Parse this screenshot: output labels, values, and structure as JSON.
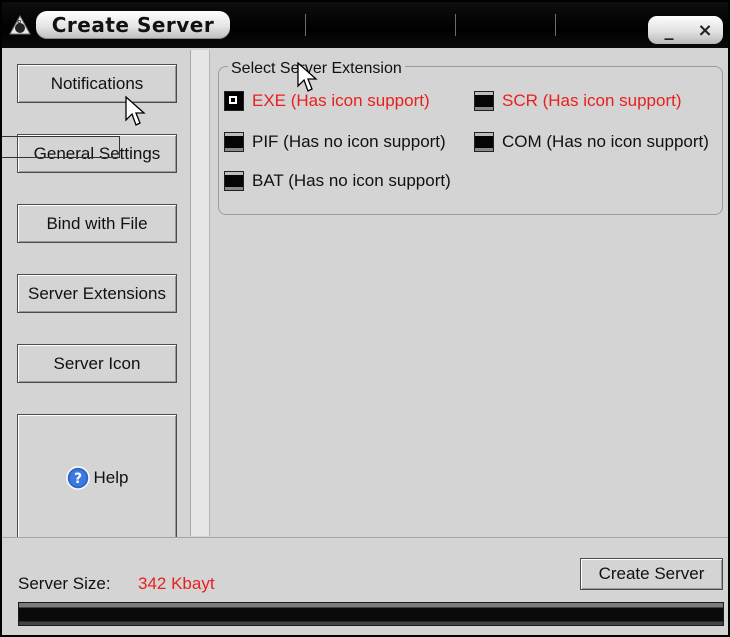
{
  "window": {
    "title": "Create Server",
    "minimize_glyph": "_",
    "close_glyph": "×",
    "app_icon": "app-logo-icon"
  },
  "sidebar": {
    "items": [
      {
        "label": "Notifications"
      },
      {
        "label": "General Settings"
      },
      {
        "label": "Bind with File"
      },
      {
        "label": "Server Extensions"
      },
      {
        "label": "Server Icon"
      },
      {
        "label": "Help",
        "icon": "help-icon"
      }
    ]
  },
  "extensions": {
    "legend": "Select Server Extension",
    "options": [
      {
        "label": "EXE (Has icon support)",
        "selected": true,
        "color": "#e8201e"
      },
      {
        "label": "SCR (Has icon support)",
        "selected": false,
        "color": "#e8201e"
      },
      {
        "label": "PIF (Has no icon support)",
        "selected": false,
        "color": "#111111"
      },
      {
        "label": "COM (Has no icon support)",
        "selected": false,
        "color": "#111111"
      },
      {
        "label": "BAT (Has no icon support)",
        "selected": false,
        "color": "#111111"
      }
    ]
  },
  "footer": {
    "size_label": "Server Size:",
    "size_value": "342 Kbayt",
    "create_button": "Create Server",
    "progress": 0
  },
  "colors": {
    "accent_red": "#e8201e",
    "panel": "#d4d4d4",
    "titlebar": "#000000"
  }
}
